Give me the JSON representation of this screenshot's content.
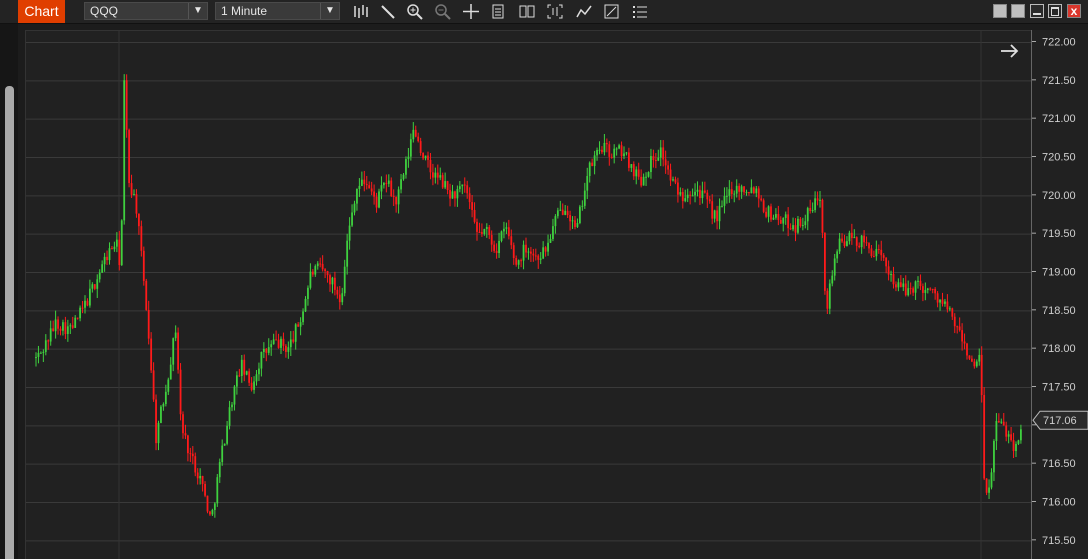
{
  "toolbar": {
    "tab_label": "Chart",
    "symbol": "QQQ",
    "interval": "1 Minute",
    "tools": [
      "bars-icon",
      "draw-icon",
      "zoom-in-icon",
      "zoom-out-icon",
      "crosshair-icon",
      "indicator-icon",
      "data-box-icon",
      "fit-icon",
      "strategy-icon",
      "template-icon",
      "list-icon"
    ]
  },
  "window_buttons": {
    "close_glyph": "x"
  },
  "chart_data": {
    "type": "candlestick",
    "ylim": [
      715.25,
      722.15
    ],
    "yticks": [
      "722.00",
      "721.50",
      "721.00",
      "720.50",
      "720.00",
      "719.50",
      "719.00",
      "718.50",
      "718.00",
      "717.50",
      "717.00",
      "716.50",
      "716.00",
      "715.50"
    ],
    "last_price": "717.06",
    "colors": {
      "up": "#3fd13f",
      "down": "#ff1a1a",
      "grid": "#3a3a3a",
      "last_price_bg": "#2a2a2a"
    },
    "path": [
      [
        0,
        717.75
      ],
      [
        15,
        717.95
      ],
      [
        30,
        718.35
      ],
      [
        45,
        718.25
      ],
      [
        60,
        718.6
      ],
      [
        70,
        718.9
      ],
      [
        80,
        719.2
      ],
      [
        90,
        719.4
      ],
      [
        95,
        719.05
      ],
      [
        98,
        721.5
      ],
      [
        103,
        720.2
      ],
      [
        110,
        719.9
      ],
      [
        120,
        718.6
      ],
      [
        125,
        717.8
      ],
      [
        130,
        716.85
      ],
      [
        140,
        717.5
      ],
      [
        150,
        718.3
      ],
      [
        155,
        717.0
      ],
      [
        165,
        716.6
      ],
      [
        175,
        716.3
      ],
      [
        185,
        715.75
      ],
      [
        195,
        716.6
      ],
      [
        205,
        717.3
      ],
      [
        215,
        717.8
      ],
      [
        225,
        717.5
      ],
      [
        235,
        717.9
      ],
      [
        250,
        718.1
      ],
      [
        262,
        718.0
      ],
      [
        275,
        718.4
      ],
      [
        285,
        719.0
      ],
      [
        295,
        719.05
      ],
      [
        305,
        718.9
      ],
      [
        315,
        718.65
      ],
      [
        320,
        719.3
      ],
      [
        330,
        720.1
      ],
      [
        340,
        720.2
      ],
      [
        350,
        719.9
      ],
      [
        360,
        720.2
      ],
      [
        370,
        719.9
      ],
      [
        380,
        720.4
      ],
      [
        388,
        720.9
      ],
      [
        395,
        720.6
      ],
      [
        405,
        720.3
      ],
      [
        415,
        720.2
      ],
      [
        425,
        720.0
      ],
      [
        440,
        720.1
      ],
      [
        450,
        719.5
      ],
      [
        460,
        719.55
      ],
      [
        470,
        719.3
      ],
      [
        480,
        719.6
      ],
      [
        490,
        719.1
      ],
      [
        500,
        719.35
      ],
      [
        510,
        719.2
      ],
      [
        520,
        719.3
      ],
      [
        530,
        719.7
      ],
      [
        540,
        719.9
      ],
      [
        550,
        719.5
      ],
      [
        560,
        720.2
      ],
      [
        565,
        720.4
      ],
      [
        575,
        720.65
      ],
      [
        585,
        720.55
      ],
      [
        595,
        720.6
      ],
      [
        605,
        720.4
      ],
      [
        615,
        720.2
      ],
      [
        625,
        720.45
      ],
      [
        635,
        720.6
      ],
      [
        645,
        720.2
      ],
      [
        655,
        720.0
      ],
      [
        665,
        720.1
      ],
      [
        675,
        720.05
      ],
      [
        690,
        719.7
      ],
      [
        705,
        720.1
      ],
      [
        715,
        720.1
      ],
      [
        730,
        720.1
      ],
      [
        740,
        719.8
      ],
      [
        755,
        719.7
      ],
      [
        770,
        719.6
      ],
      [
        785,
        719.8
      ],
      [
        795,
        720.05
      ],
      [
        800,
        718.5
      ],
      [
        810,
        719.3
      ],
      [
        820,
        719.45
      ],
      [
        835,
        719.4
      ],
      [
        850,
        719.25
      ],
      [
        860,
        719.1
      ],
      [
        870,
        718.85
      ],
      [
        880,
        718.75
      ],
      [
        890,
        718.85
      ],
      [
        900,
        718.8
      ],
      [
        910,
        718.7
      ],
      [
        920,
        718.55
      ],
      [
        930,
        718.3
      ],
      [
        940,
        718.0
      ],
      [
        950,
        717.7
      ],
      [
        955,
        718.05
      ],
      [
        957,
        716.3
      ],
      [
        962,
        716.0
      ],
      [
        970,
        717.05
      ],
      [
        980,
        716.95
      ],
      [
        990,
        716.7
      ],
      [
        996,
        717.06
      ]
    ]
  }
}
